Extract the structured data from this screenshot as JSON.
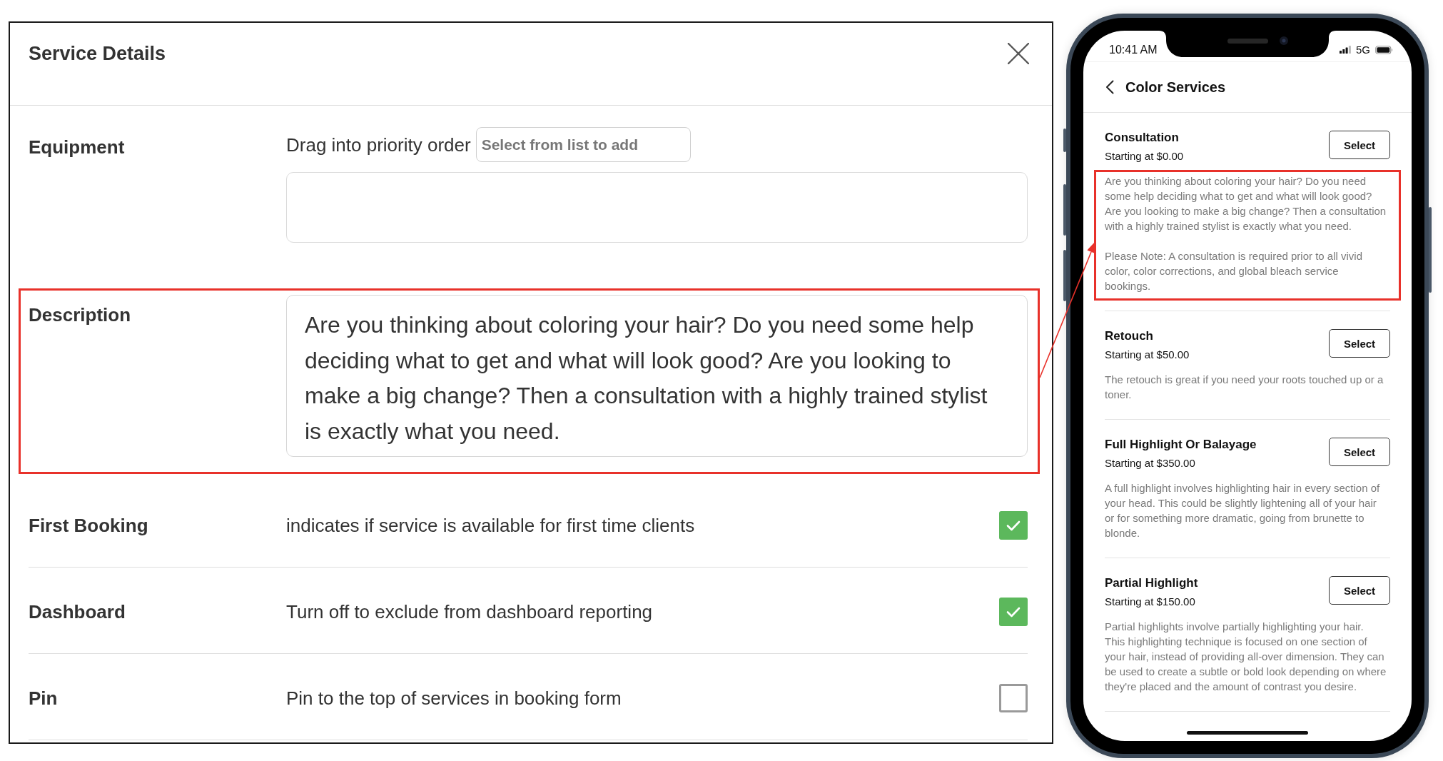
{
  "dialog": {
    "title": "Service Details",
    "rows": [
      {
        "kind": "picker",
        "label": "Equipment",
        "hint": "Drag into priority order",
        "select": {
          "placeholder": "Select from list to add"
        },
        "highlighted": false
      },
      {
        "kind": "text",
        "label": "Description",
        "value": "Are you thinking about coloring your hair? Do you need some help deciding what to get and what will look good? Are you looking to make a big change? Then a consultation with a highly trained stylist is exactly what you need.",
        "highlighted": true
      },
      {
        "kind": "checkbox",
        "label": "First Booking",
        "hint": "indicates if service is available for first time clients",
        "checked": true,
        "highlighted": false
      },
      {
        "kind": "checkbox",
        "label": "Dashboard",
        "hint": "Turn off to exclude from dashboard reporting",
        "checked": true,
        "highlighted": false
      },
      {
        "kind": "checkbox",
        "label": "Pin",
        "hint": "Pin to the top of services in booking form",
        "checked": false,
        "highlighted": false
      }
    ]
  },
  "phone": {
    "status_bar": {
      "time": "10:41 AM",
      "network": "5G"
    },
    "title": "Color Services",
    "services": [
      {
        "name": "Consultation",
        "price": "Starting at $0.00",
        "button": "Select",
        "description": [
          "Are you thinking about coloring your hair? Do you need some help deciding what to get and what will look good? Are you looking to make a big change? Then a consultation with a highly trained stylist is exactly what you need.",
          "Please Note: A consultation is required prior to all vivid color, color corrections, and global bleach service bookings."
        ],
        "highlighted": true
      },
      {
        "name": "Retouch",
        "price": "Starting at $50.00",
        "button": "Select",
        "description": [
          "The retouch is great if you need your roots touched up or a toner."
        ],
        "highlighted": false
      },
      {
        "name": "Full Highlight Or Balayage",
        "price": "Starting at $350.00",
        "button": "Select",
        "description": [
          "A full highlight involves highlighting hair in every section of your head. This could be slightly lightening all of your hair or for something more dramatic, going from brunette to blonde."
        ],
        "highlighted": false
      },
      {
        "name": "Partial Highlight",
        "price": "Starting at $150.00",
        "button": "Select",
        "description": [
          "Partial highlights involve partially highlighting your hair. This highlighting technique is focused on one section of your hair, instead of providing all-over dimension. They can be used to create a subtle or bold look depending on where they're placed and the amount of contrast you desire."
        ],
        "highlighted": false
      }
    ]
  }
}
